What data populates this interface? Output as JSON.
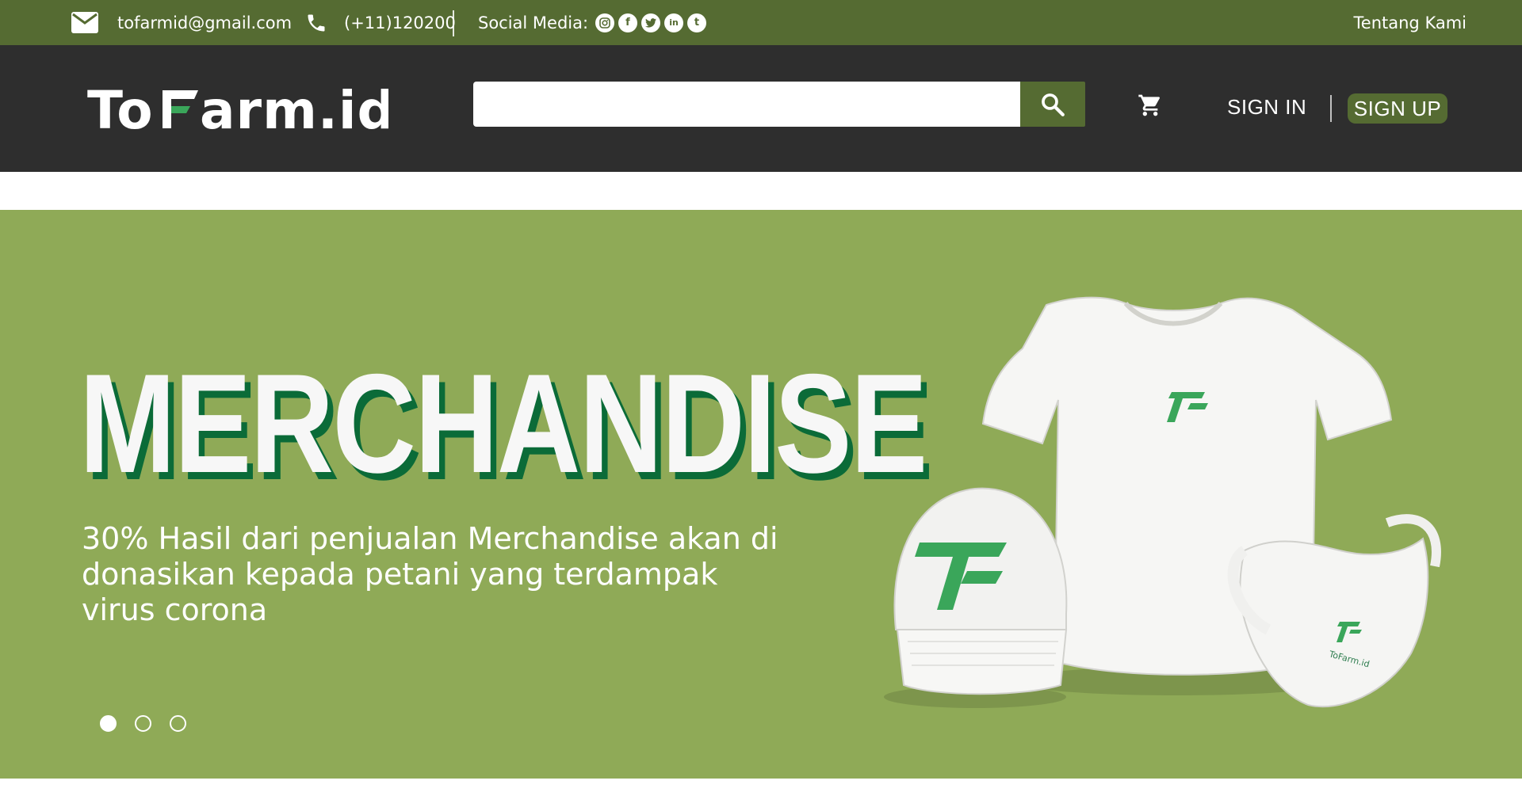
{
  "topbar": {
    "email": "tofarmid@gmail.com",
    "phone": "(+11)120200",
    "social_label": "Social Media:",
    "social_icons": [
      "instagram-icon",
      "facebook-icon",
      "twitter-icon",
      "linkedin-icon",
      "tumblr-icon"
    ],
    "about_link": "Tentang Kami"
  },
  "header": {
    "logo": "ToFarm.id",
    "search": {
      "value": "",
      "placeholder": ""
    },
    "signin": "SIGN IN",
    "signup": "SIGN UP"
  },
  "hero": {
    "title": "MERCHANDISE",
    "subtitle": "30% Hasil dari penjualan Merchandise akan di donasikan kepada petani yang terdampak virus corona",
    "slides_count": 3,
    "active_slide": 1
  },
  "colors": {
    "topbar": "#556b32",
    "header": "#2e2e2e",
    "hero": "#8faa57",
    "title_shadow": "#0b6b38",
    "brand_green": "#3aa65a"
  }
}
